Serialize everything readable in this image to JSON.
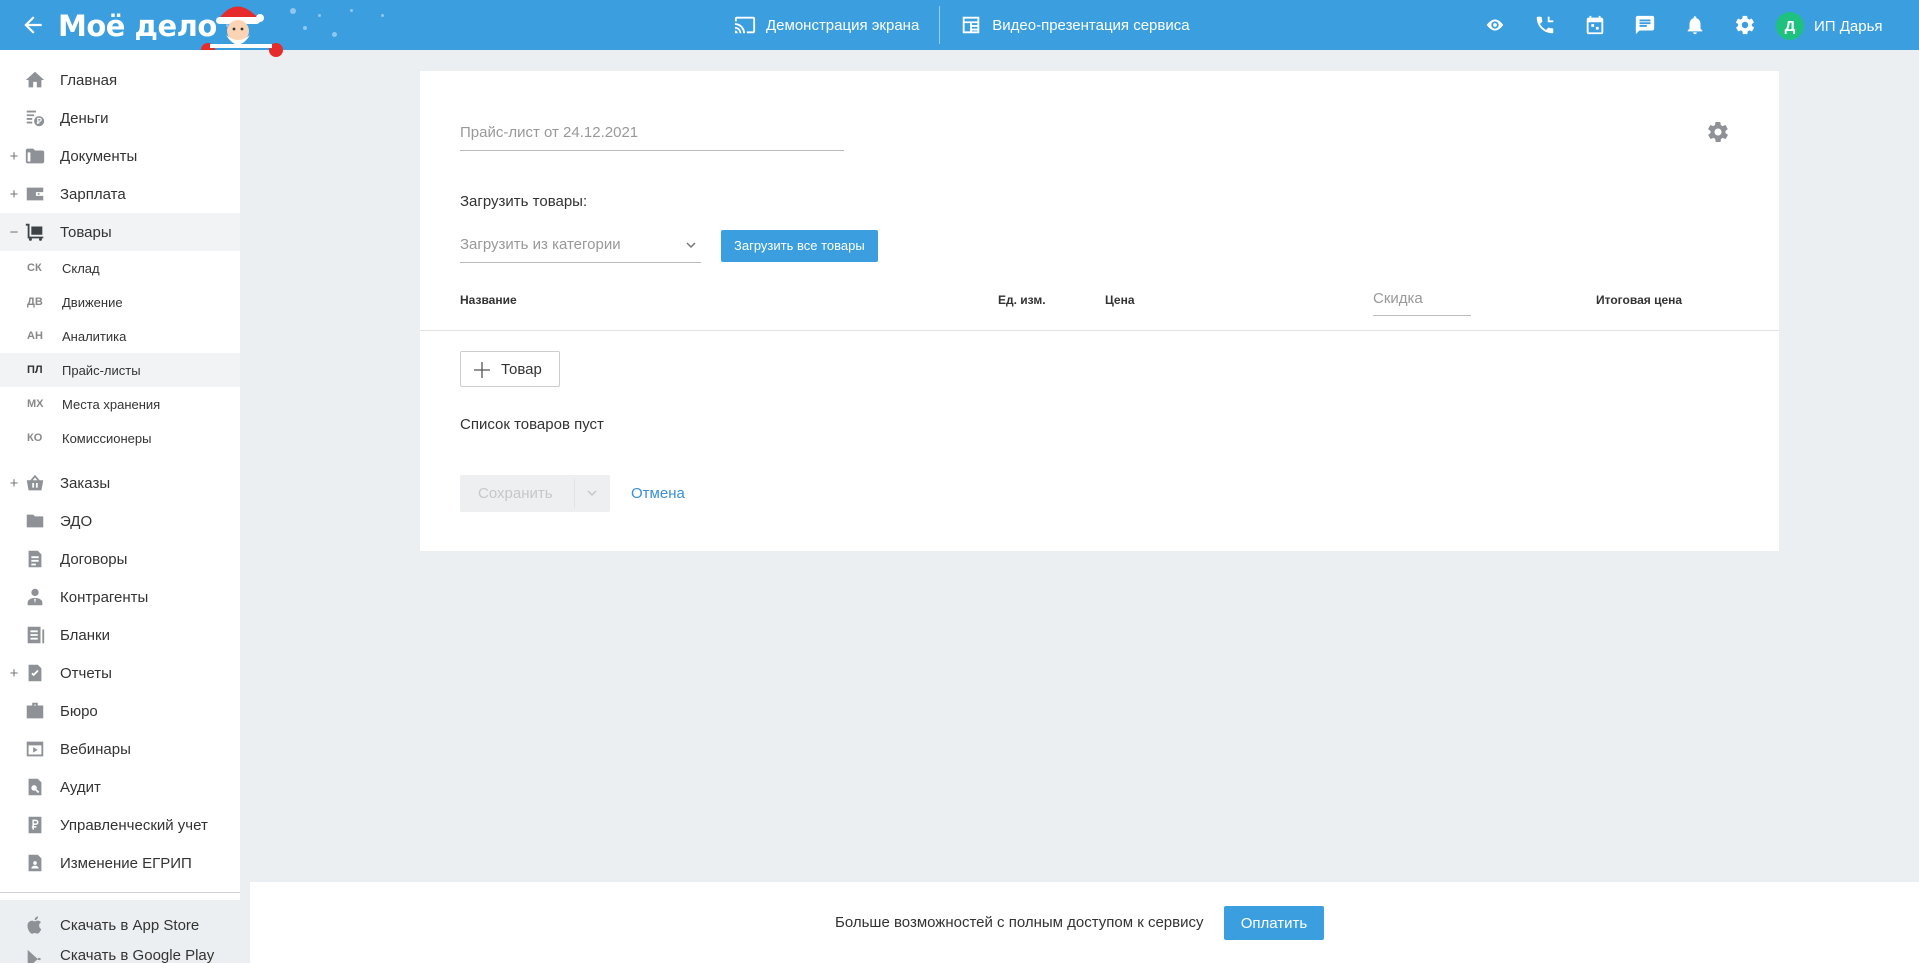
{
  "header": {
    "logo": "Моё дело",
    "screen_demo": "Демонстрация экрана",
    "video_presentation": "Видео-презентация сервиса",
    "user_initial": "Д",
    "user_name": "ИП Дарья"
  },
  "sidebar": {
    "items": [
      {
        "label": "Главная",
        "icon": "home-icon",
        "expander": ""
      },
      {
        "label": "Деньги",
        "icon": "money-icon",
        "expander": ""
      },
      {
        "label": "Документы",
        "icon": "folder-icon",
        "expander": "+"
      },
      {
        "label": "Зарплата",
        "icon": "wallet-icon",
        "expander": "+"
      },
      {
        "label": "Товары",
        "icon": "cart-icon",
        "expander": "−"
      },
      {
        "label": "Заказы",
        "icon": "basket-icon",
        "expander": "+"
      },
      {
        "label": "ЭДО",
        "icon": "edo-icon",
        "expander": ""
      },
      {
        "label": "Договоры",
        "icon": "contract-icon",
        "expander": ""
      },
      {
        "label": "Контрагенты",
        "icon": "contractors-icon",
        "expander": ""
      },
      {
        "label": "Бланки",
        "icon": "forms-icon",
        "expander": ""
      },
      {
        "label": "Отчеты",
        "icon": "reports-icon",
        "expander": "+"
      },
      {
        "label": "Бюро",
        "icon": "briefcase-icon",
        "expander": ""
      },
      {
        "label": "Вебинары",
        "icon": "webinar-icon",
        "expander": ""
      },
      {
        "label": "Аудит",
        "icon": "audit-icon",
        "expander": ""
      },
      {
        "label": "Управленческий учет",
        "icon": "ruble-doc-icon",
        "expander": ""
      },
      {
        "label": "Изменение ЕГРИП",
        "icon": "egrip-icon",
        "expander": ""
      }
    ],
    "subitems": [
      {
        "abbr": "СК",
        "label": "Склад"
      },
      {
        "abbr": "ДВ",
        "label": "Движение"
      },
      {
        "abbr": "АН",
        "label": "Аналитика"
      },
      {
        "abbr": "ПЛ",
        "label": "Прайс-листы"
      },
      {
        "abbr": "МХ",
        "label": "Места хранения"
      },
      {
        "abbr": "КО",
        "label": "Комиссионеры"
      }
    ],
    "bottom": [
      {
        "label": "Скачать в App Store",
        "icon": "apple-icon"
      },
      {
        "label": "Скачать в Google Play",
        "icon": "google-play-icon"
      }
    ]
  },
  "main": {
    "price_list_title": "Прайс-лист от 24.12.2021",
    "load_label": "Загрузить товары:",
    "category_placeholder": "Загрузить из категории",
    "load_all_button": "Загрузить все товары",
    "columns": {
      "name": "Название",
      "unit": "Ед. изм.",
      "price": "Цена",
      "discount": "Скидка",
      "total": "Итоговая цена"
    },
    "add_item_button": "Товар",
    "empty_list": "Список товаров пуст",
    "save_button": "Сохранить",
    "cancel_link": "Отмена"
  },
  "banner": {
    "text": "Больше возможностей с полным доступом к сервису",
    "pay_button": "Оплатить"
  },
  "colors": {
    "accent": "#3b9fdf",
    "avatar": "#1fc17f",
    "background": "#eceff2"
  }
}
